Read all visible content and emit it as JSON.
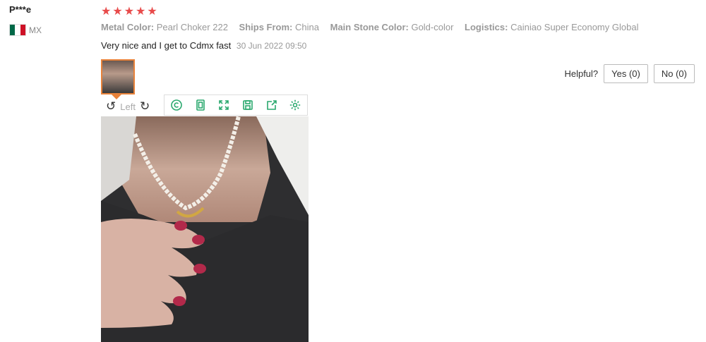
{
  "reviewer": {
    "name": "P***e",
    "country_code": "MX",
    "flag_colors": [
      "#006847",
      "#ffffff",
      "#ce1126"
    ]
  },
  "rating": {
    "stars": 5,
    "color": "#e84b4b"
  },
  "attributes": [
    {
      "key": "Metal Color:",
      "value": "Pearl Choker 222"
    },
    {
      "key": "Ships From:",
      "value": "China"
    },
    {
      "key": "Main Stone Color:",
      "value": "Gold-color"
    },
    {
      "key": "Logistics:",
      "value": "Cainiao Super Economy Global"
    }
  ],
  "review": {
    "text": "Very nice and I get to Cdmx fast",
    "date": "30 Jun 2022 09:50"
  },
  "helpful": {
    "label": "Helpful?",
    "yes": "Yes (0)",
    "no": "No (0)"
  },
  "viewer": {
    "rotate_label": "Left",
    "tools": [
      "copyright-icon",
      "fit-page-icon",
      "fullscreen-icon",
      "save-icon",
      "share-icon",
      "settings-icon"
    ],
    "accent": "#2aa86e"
  }
}
